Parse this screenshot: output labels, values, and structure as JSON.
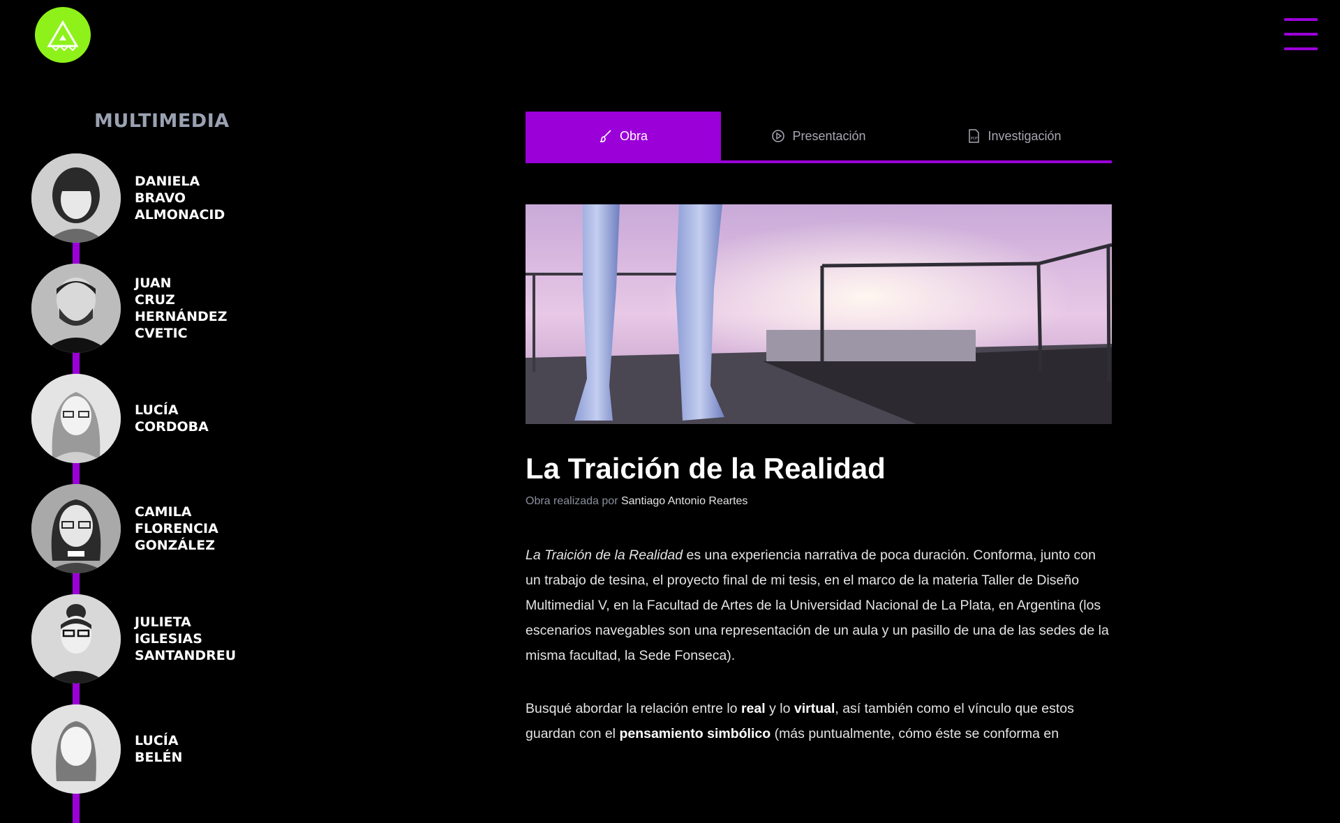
{
  "header": {
    "logo_icon": "triangle-logo-icon",
    "menu_icon": "hamburger-menu-icon",
    "accent_color": "#9b00d9",
    "logo_color": "#8ef21a"
  },
  "sidebar": {
    "section_title": "MULTIMEDIA",
    "artists": [
      {
        "first": "DANIELA",
        "mid": "BRAVO",
        "last": "ALMONACID",
        "extra": ""
      },
      {
        "first": "JUAN",
        "mid": "CRUZ",
        "last": "HERNÁNDEZ",
        "extra": "CVETIC"
      },
      {
        "first": "LUCÍA",
        "mid": "CORDOBA",
        "last": "",
        "extra": ""
      },
      {
        "first": "CAMILA",
        "mid": "FLORENCIA",
        "last": "GONZÁLEZ",
        "extra": ""
      },
      {
        "first": "JULIETA",
        "mid": "IGLESIAS",
        "last": "SANTANDREU",
        "extra": ""
      },
      {
        "first": "LUCÍA",
        "mid": "BELÉN",
        "last": "",
        "extra": ""
      }
    ]
  },
  "tabs": [
    {
      "label": "Obra",
      "icon": "brush-icon"
    },
    {
      "label": "Presentación",
      "icon": "play-circle-icon"
    },
    {
      "label": "Investigación",
      "icon": "pdf-file-icon"
    }
  ],
  "work": {
    "title": "La Traición de la Realidad",
    "credit_prefix": "Obra realizada por",
    "author": "Santiago Antonio Reartes",
    "p1_italic": "La Traición de la Realidad",
    "p1_rest": " es una experiencia narrativa de poca duración. Conforma, junto con un trabajo de tesina, el proyecto final de mi tesis, en el marco de la materia Taller de Diseño Multimedial V, en la Facultad de Artes de la Universidad Nacional de La Plata, en Argentina (los escenarios navegables son una representación de un aula y un pasillo de una de las sedes de la misma facultad, la Sede Fonseca).",
    "p2_a": "Busqué abordar la relación entre lo ",
    "p2_b": "real",
    "p2_c": " y lo ",
    "p2_d": "virtual",
    "p2_e": ", así también como el vínculo que estos guardan con el ",
    "p2_f": "pensamiento simbólico",
    "p2_g": " (más puntualmente, cómo éste se conforma en"
  }
}
